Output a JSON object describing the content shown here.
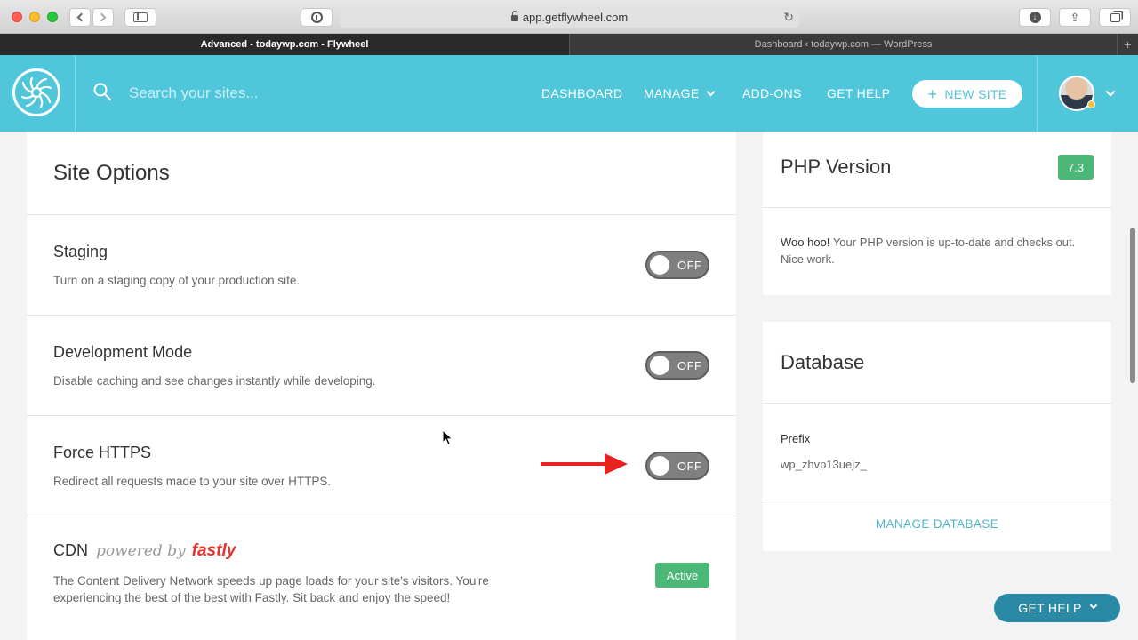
{
  "browser": {
    "url": "app.getflywheel.com",
    "tabs": [
      {
        "label": "Advanced - todaywp.com - Flywheel",
        "active": true
      },
      {
        "label": "Dashboard ‹ todaywp.com — WordPress",
        "active": false
      }
    ]
  },
  "header": {
    "search_placeholder": "Search your sites...",
    "nav": {
      "dashboard": "DASHBOARD",
      "manage": "MANAGE",
      "addons": "ADD-ONS",
      "help": "GET HELP"
    },
    "new_site": "NEW SITE",
    "new_site_icon": "plus-icon",
    "accent": "#50c6db"
  },
  "site_options": {
    "title": "Site Options",
    "rows": [
      {
        "title": "Staging",
        "desc": "Turn on a staging copy of your production site.",
        "state": "OFF"
      },
      {
        "title": "Development Mode",
        "desc": "Disable caching and see changes instantly while developing.",
        "state": "OFF"
      },
      {
        "title": "Force HTTPS",
        "desc": "Redirect all requests made to your site over HTTPS.",
        "state": "OFF"
      }
    ],
    "cdn": {
      "title": "CDN",
      "powered_by": "powered by",
      "brand": "fastly",
      "desc1": "The Content Delivery Network speeds up page loads for your site's visitors. You're",
      "desc2": "experiencing the best of the best with Fastly. Sit back and enjoy the speed!",
      "status": "Active"
    }
  },
  "php": {
    "title": "PHP Version",
    "version": "7.3",
    "msg_strong": "Woo hoo!",
    "msg": "Your PHP version is up-to-date and checks out. Nice work."
  },
  "database": {
    "title": "Database",
    "prefix_label": "Prefix",
    "prefix_value": "wp_zhvp13uejz_",
    "manage": "MANAGE DATABASE"
  },
  "help_button": "GET HELP",
  "colors": {
    "accent": "#50c6db",
    "success": "#4cb877",
    "toggle_off": "#7f7f7f",
    "arrow": "#e8231f",
    "help_button": "#2a8aa6"
  }
}
